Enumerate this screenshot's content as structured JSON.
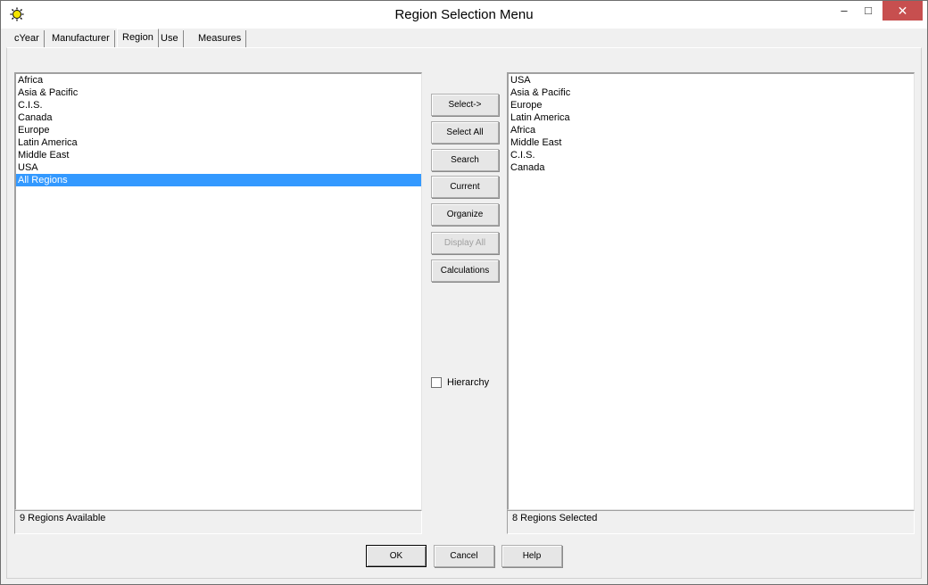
{
  "window": {
    "title": "Region Selection Menu",
    "icon": "sun-app-icon",
    "controls": {
      "minimize": "–",
      "maximize": "□",
      "close": "✕"
    }
  },
  "tabs": [
    {
      "label": "cYear"
    },
    {
      "label": "Manufacturer"
    },
    {
      "label": "Region",
      "active": true
    },
    {
      "label": "Use"
    },
    {
      "label": "Measures"
    }
  ],
  "available": {
    "items": [
      "Africa",
      "Asia & Pacific",
      "C.I.S.",
      "Canada",
      "Europe",
      "Latin America",
      "Middle East",
      "USA",
      "All Regions"
    ],
    "selected_item": "All Regions",
    "status": "9 Regions Available"
  },
  "selected": {
    "items": [
      "USA",
      "Asia & Pacific",
      "Europe",
      "Latin America",
      "Africa",
      "Middle East",
      "C.I.S.",
      "Canada"
    ],
    "status": "8 Regions Selected"
  },
  "actions": {
    "select": "Select->",
    "select_all": "Select All",
    "search": "Search",
    "current": "Current",
    "organize": "Organize",
    "display_all": "Display All",
    "calculations": "Calculations"
  },
  "hierarchy": {
    "label": "Hierarchy",
    "checked": false
  },
  "footer": {
    "ok": "OK",
    "cancel": "Cancel",
    "help": "Help"
  },
  "colors": {
    "selection": "#3399ff",
    "close_button": "#c74f4f"
  }
}
